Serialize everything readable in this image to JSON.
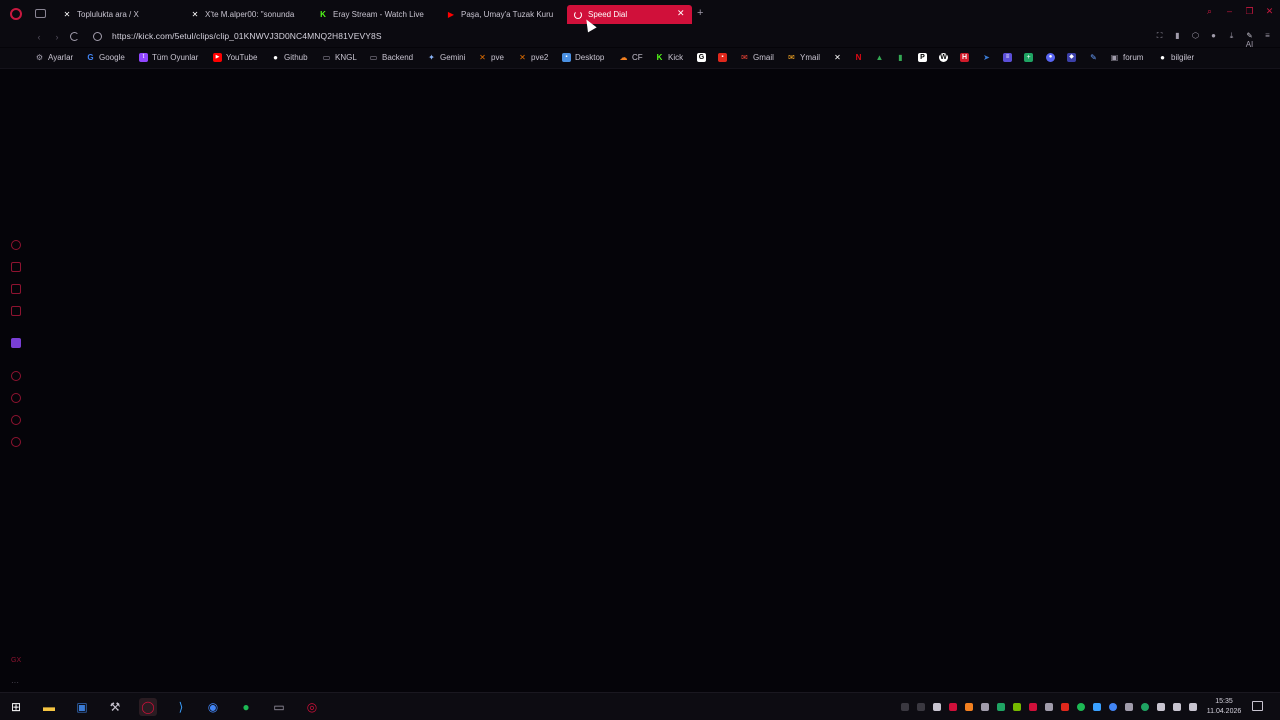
{
  "browser": {
    "tabs": [
      {
        "label": "Toplulukta ara / X",
        "icon": "x-icon"
      },
      {
        "label": "X'te M.alper00: \"sonunda",
        "icon": "x-icon"
      },
      {
        "label": "Eray Stream - Watch Live",
        "icon": "kick-icon"
      },
      {
        "label": "Paşa, Umay'a Tuzak Kuru",
        "icon": "youtube-icon"
      },
      {
        "label": "Speed Dial",
        "icon": "loading-spinner",
        "active": true
      }
    ],
    "url": "https://kick.com/5etul/clips/clip_01KNWVJ3D0NC4MNQ2H81VEVY8S",
    "ai_label": "AI"
  },
  "bookmarks": [
    {
      "label": "Ayarlar",
      "icon": "gear-icon",
      "color": "#a19cab"
    },
    {
      "label": "Google",
      "icon": "google-icon",
      "color": "#4285f4"
    },
    {
      "label": "Tüm Oyunlar",
      "icon": "twitch-icon",
      "color": "#9146ff"
    },
    {
      "label": "YouTube",
      "icon": "youtube-icon",
      "color": "#ff0000"
    },
    {
      "label": "Github",
      "icon": "github-icon",
      "color": "#ffffff"
    },
    {
      "label": "KNGL",
      "icon": "folder-icon",
      "color": "#a19cab"
    },
    {
      "label": "Backend",
      "icon": "folder-icon",
      "color": "#a19cab"
    },
    {
      "label": "Gemini",
      "icon": "gemini-icon",
      "color": "#8ab4f8"
    },
    {
      "label": "pve",
      "icon": "proxmox-icon",
      "color": "#e57000"
    },
    {
      "label": "pve2",
      "icon": "proxmox-icon",
      "color": "#e57000"
    },
    {
      "label": "Desktop",
      "icon": "desktop-icon",
      "color": "#4a90e2"
    },
    {
      "label": "CF",
      "icon": "cloudflare-icon",
      "color": "#f38020"
    },
    {
      "label": "Kick",
      "icon": "kick-icon",
      "color": "#53fc18"
    },
    {
      "label": "Gmail",
      "icon": "gmail-icon",
      "color": "#ea4335"
    },
    {
      "label": "Ymail",
      "icon": "mail-icon",
      "color": "#f5a623"
    },
    {
      "label": "forum",
      "icon": "forum-icon",
      "color": "#a19cab"
    },
    {
      "label": "bilgiler",
      "icon": "github-icon",
      "color": "#ffffff"
    }
  ],
  "taskbar": {
    "clock_time": "15:35",
    "clock_date": "11.04.2026"
  },
  "colors": {
    "accent": "#d0103a",
    "background": "#050409"
  }
}
